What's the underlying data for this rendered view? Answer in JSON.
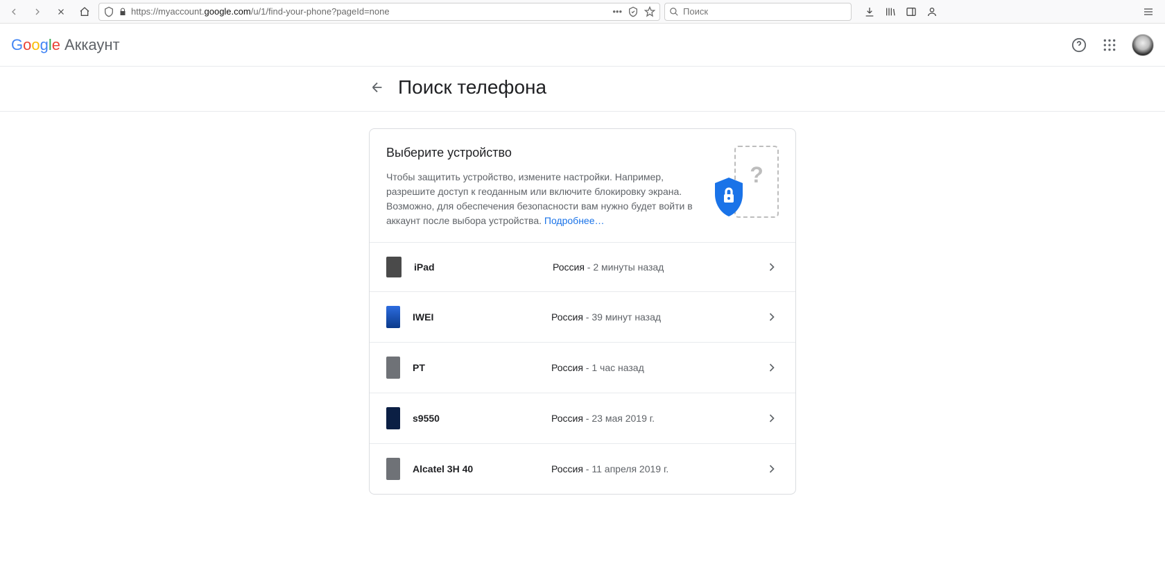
{
  "browser": {
    "url_prefix": "https://myaccount.",
    "url_domain": "google.com",
    "url_suffix": "/u/1/find-your-phone?pageId=none",
    "search_placeholder": "Поиск"
  },
  "header": {
    "logo_account_word": "Аккаунт"
  },
  "page": {
    "title": "Поиск телефона",
    "card": {
      "heading": "Выберите устройство",
      "description": "Чтобы защитить устройство, измените настройки. Например, разрешите доступ к геоданным или включите блокировку экрана. Возможно, для обеспечения безопасности вам нужно будет войти в аккаунт после выбора устройства. ",
      "learn_more": "Подробнее…"
    },
    "devices": [
      {
        "name": "iPad",
        "location": "Россия",
        "time": "2 минуты назад",
        "thumb": "tablet"
      },
      {
        "name": "IWEI",
        "location": "Россия",
        "time": "39 минут назад",
        "thumb": "blue1"
      },
      {
        "name": "PT",
        "location": "Россия",
        "time": "1 час назад",
        "thumb": "grey"
      },
      {
        "name": "s9550",
        "location": "Россия",
        "time": "23 мая 2019 г.",
        "thumb": "darkblue"
      },
      {
        "name": "Alcatel 3H 40",
        "location": "Россия",
        "time": "11 апреля 2019 г.",
        "thumb": "grey"
      }
    ]
  }
}
